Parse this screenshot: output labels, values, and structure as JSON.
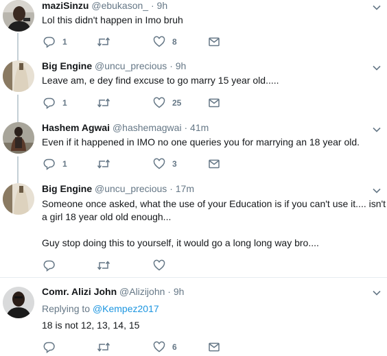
{
  "tweets": [
    {
      "name": "maziSinzu",
      "handle": "@ebukason_",
      "dot": "·",
      "time": "9h",
      "text": "Lol this didn't happen in Imo bruh",
      "reply_count": "1",
      "retweet_count": "",
      "like_count": "8"
    },
    {
      "name": "Big Engine",
      "handle": "@uncu_precious",
      "dot": "·",
      "time": "9h",
      "text": "Leave am, e dey find excuse to go marry 15 year old.....",
      "reply_count": "1",
      "retweet_count": "",
      "like_count": "25"
    },
    {
      "name": "Hashem Agwai",
      "handle": "@hashemagwai",
      "dot": "·",
      "time": "41m",
      "text": "Even if it happened in IMO no one queries you for marrying an 18 year old.",
      "reply_count": "1",
      "retweet_count": "",
      "like_count": "3"
    },
    {
      "name": "Big Engine",
      "handle": "@uncu_precious",
      "dot": "·",
      "time": "17m",
      "text_line1": "Someone once asked, what the use of your Education is if you can't use it.... isn't",
      "text_line2": "a girl 18 year old old enough...",
      "text_line3": "Guy stop doing this to yourself, it would go a long long way bro....",
      "reply_count": "",
      "retweet_count": "",
      "like_count": ""
    },
    {
      "name": "Comr. Alizi John",
      "handle": "@Alizijohn",
      "dot": "·",
      "time": "9h",
      "replying_label": "Replying to",
      "replying_mention": "@Kempez2017",
      "text": "18 is not 12, 13, 14, 15",
      "reply_count": "",
      "retweet_count": "",
      "like_count": "6"
    }
  ],
  "colors": {
    "text": "#14171a",
    "secondary": "#657786",
    "link": "#1b95e0",
    "separator": "#e6ecf0",
    "thread_line": "#c4cfd6"
  },
  "icons": {
    "reply": "reply-icon",
    "retweet": "retweet-icon",
    "like": "heart-icon",
    "dm": "envelope-icon",
    "menu": "chevron-down-icon"
  }
}
